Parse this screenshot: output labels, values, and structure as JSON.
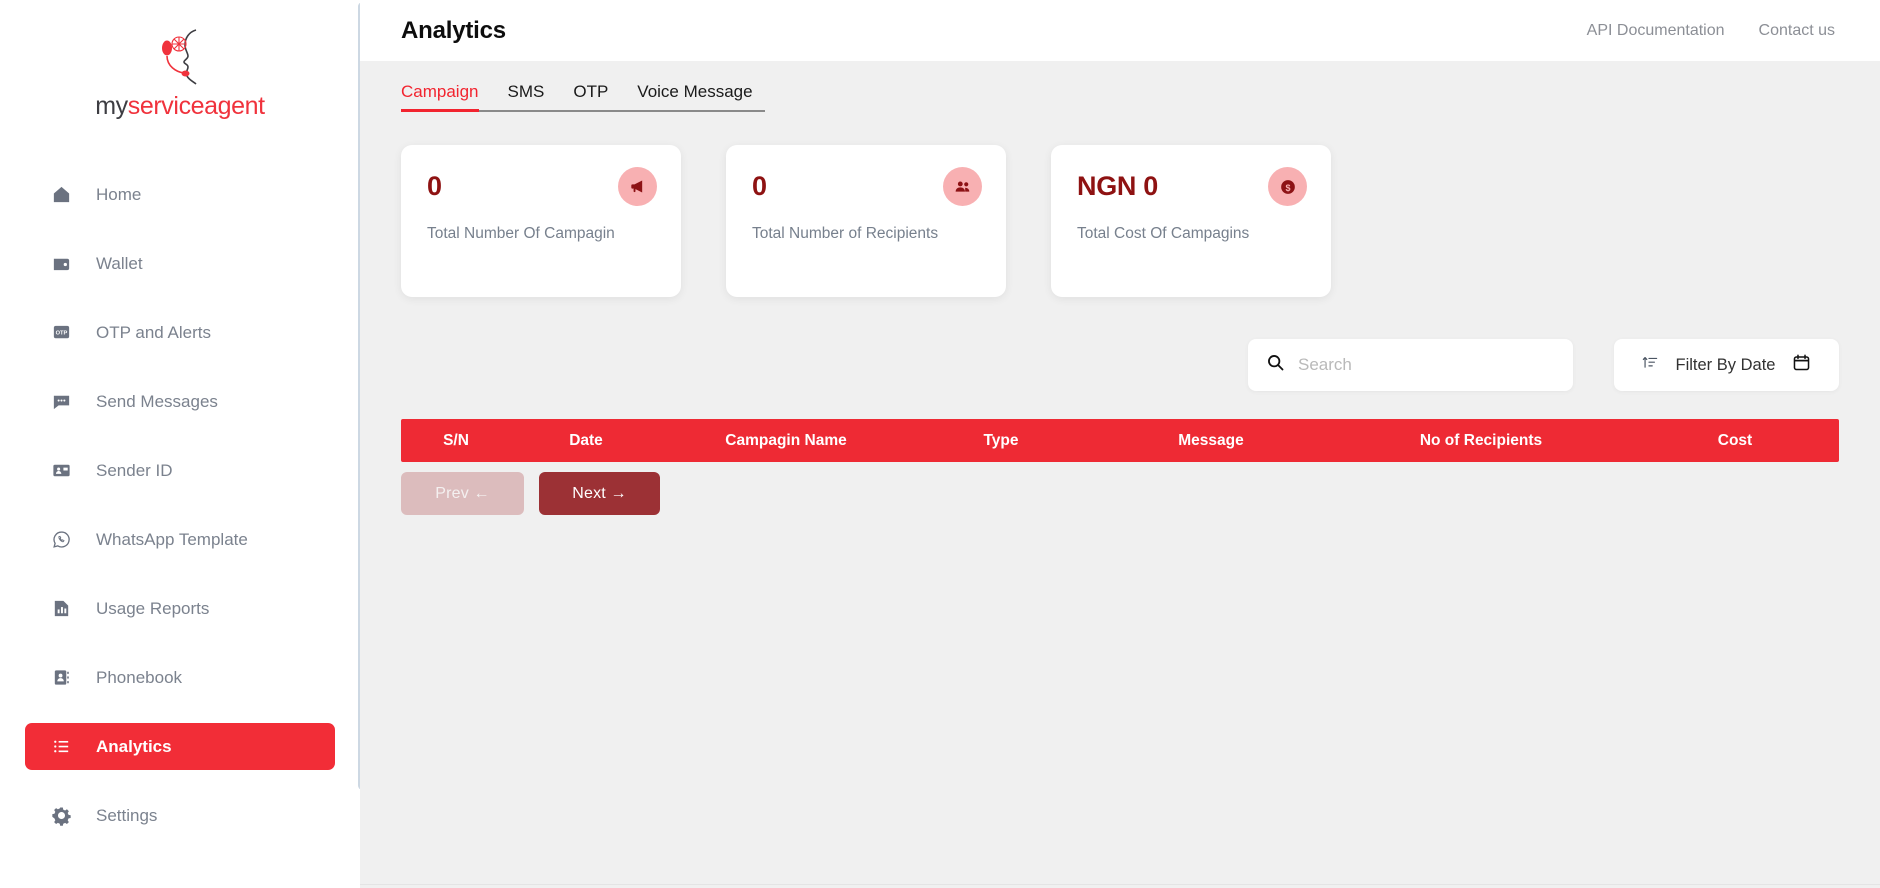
{
  "brand": {
    "name_part1": "my",
    "name_part2": "serviceagent",
    "logo_icon": "headset-profile-icon",
    "accent_color": "#f0323c"
  },
  "sidebar": {
    "items": [
      {
        "label": "Home",
        "icon": "home-icon",
        "active": false
      },
      {
        "label": "Wallet",
        "icon": "wallet-icon",
        "active": false
      },
      {
        "label": "OTP and Alerts",
        "icon": "otp-badge-icon",
        "active": false
      },
      {
        "label": "Send Messages",
        "icon": "chat-bubble-icon",
        "active": false
      },
      {
        "label": "Sender ID",
        "icon": "id-card-icon",
        "active": false
      },
      {
        "label": "WhatsApp Template",
        "icon": "whatsapp-icon",
        "active": false
      },
      {
        "label": "Usage Reports",
        "icon": "report-chart-icon",
        "active": false
      },
      {
        "label": "Phonebook",
        "icon": "contact-book-icon",
        "active": false
      },
      {
        "label": "Analytics",
        "icon": "list-icon",
        "active": true
      },
      {
        "label": "Settings",
        "icon": "gear-icon",
        "active": false
      }
    ]
  },
  "header": {
    "title": "Analytics",
    "links": [
      {
        "label": "API Documentation"
      },
      {
        "label": "Contact us"
      }
    ]
  },
  "tabs": {
    "items": [
      {
        "label": "Campaign",
        "active": true
      },
      {
        "label": "SMS",
        "active": false
      },
      {
        "label": "OTP",
        "active": false
      },
      {
        "label": "Voice Message",
        "active": false
      }
    ]
  },
  "stat_cards": [
    {
      "value": "0",
      "label": "Total Number Of Campagin",
      "icon": "megaphone-icon"
    },
    {
      "value": "0",
      "label": "Total Number of Recipients",
      "icon": "people-icon"
    },
    {
      "value": "NGN 0",
      "label": "Total Cost Of Campagins",
      "icon": "dollar-coin-icon"
    }
  ],
  "controls": {
    "search": {
      "placeholder": "Search",
      "value": "",
      "icon": "search-icon"
    },
    "filter": {
      "label": "Filter By Date",
      "left_icon": "sort-icon",
      "right_icon": "calendar-icon"
    }
  },
  "table": {
    "columns": [
      "S/N",
      "Date",
      "Campagin Name",
      "Type",
      "Message",
      "No of Recipients",
      "Cost"
    ],
    "rows": []
  },
  "pagination": {
    "prev_label": "Prev ←",
    "next_label": "Next →"
  },
  "colors": {
    "brand_red": "#ee2a34",
    "dark_red": "#8e1212",
    "next_button": "#9c3135",
    "prev_button": "#dcbcbd",
    "icon_bubble": "#f8b0b2",
    "page_bg": "#f0f0f0"
  }
}
